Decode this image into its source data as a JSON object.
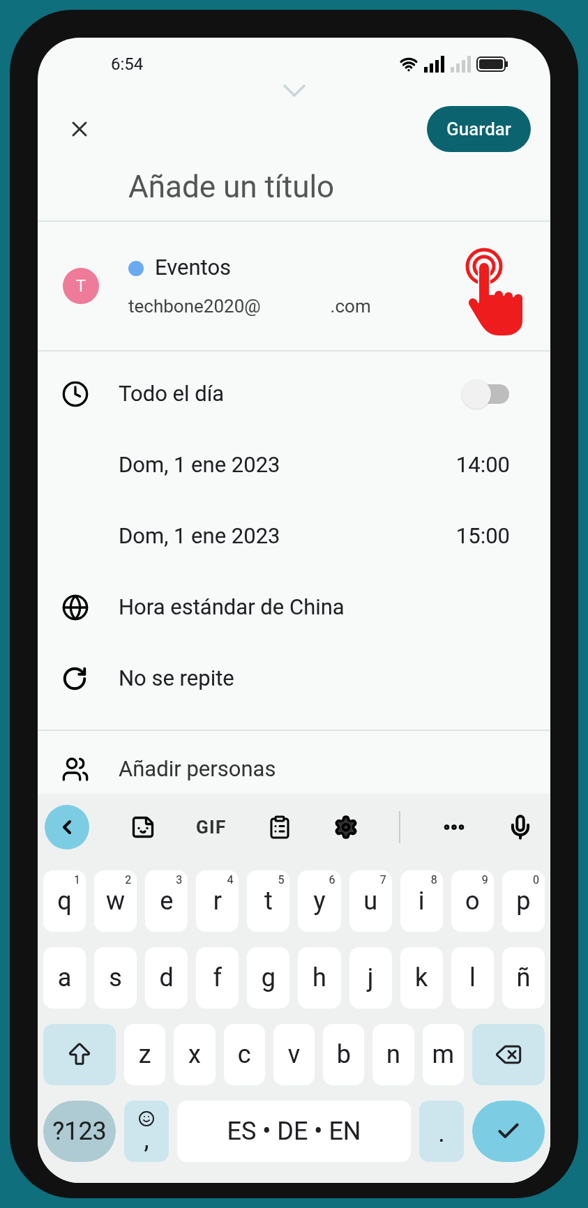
{
  "status_bar": {
    "time": "6:54"
  },
  "header": {
    "save_label": "Guardar",
    "title_placeholder": "Añade un título"
  },
  "calendar": {
    "avatar_letter": "T",
    "name": "Eventos",
    "color": "#6aaaf0",
    "email_parts": [
      "techbone2020@",
      ".com"
    ]
  },
  "all_day": {
    "label": "Todo el día",
    "on": false
  },
  "start": {
    "date": "Dom, 1 ene 2023",
    "time": "14:00"
  },
  "end": {
    "date": "Dom, 1 ene 2023",
    "time": "15:00"
  },
  "timezone": "Hora estándar de China",
  "repeat": "No se repite",
  "people": "Añadir personas",
  "keyboard": {
    "toolbar_gif": "GIF",
    "rows": [
      [
        {
          "kind": "letter",
          "label": "q",
          "hint": "1"
        },
        {
          "kind": "letter",
          "label": "w",
          "hint": "2"
        },
        {
          "kind": "letter",
          "label": "e",
          "hint": "3"
        },
        {
          "kind": "letter",
          "label": "r",
          "hint": "4"
        },
        {
          "kind": "letter",
          "label": "t",
          "hint": "5"
        },
        {
          "kind": "letter",
          "label": "y",
          "hint": "6"
        },
        {
          "kind": "letter",
          "label": "u",
          "hint": "7"
        },
        {
          "kind": "letter",
          "label": "i",
          "hint": "8"
        },
        {
          "kind": "letter",
          "label": "o",
          "hint": "9"
        },
        {
          "kind": "letter",
          "label": "p",
          "hint": "0"
        }
      ],
      [
        {
          "kind": "letter",
          "label": "a"
        },
        {
          "kind": "letter",
          "label": "s"
        },
        {
          "kind": "letter",
          "label": "d"
        },
        {
          "kind": "letter",
          "label": "f"
        },
        {
          "kind": "letter",
          "label": "g"
        },
        {
          "kind": "letter",
          "label": "h"
        },
        {
          "kind": "letter",
          "label": "j"
        },
        {
          "kind": "letter",
          "label": "k"
        },
        {
          "kind": "letter",
          "label": "l"
        },
        {
          "kind": "letter",
          "label": "ñ"
        }
      ],
      [
        {
          "kind": "shift"
        },
        {
          "kind": "letter",
          "label": "z"
        },
        {
          "kind": "letter",
          "label": "x"
        },
        {
          "kind": "letter",
          "label": "c"
        },
        {
          "kind": "letter",
          "label": "v"
        },
        {
          "kind": "letter",
          "label": "b"
        },
        {
          "kind": "letter",
          "label": "n"
        },
        {
          "kind": "letter",
          "label": "m"
        },
        {
          "kind": "backspace"
        }
      ]
    ],
    "bottom_row": {
      "symbols": "?123",
      "emoji_comma": ",",
      "space": "ES • DE • EN",
      "period": "."
    }
  }
}
